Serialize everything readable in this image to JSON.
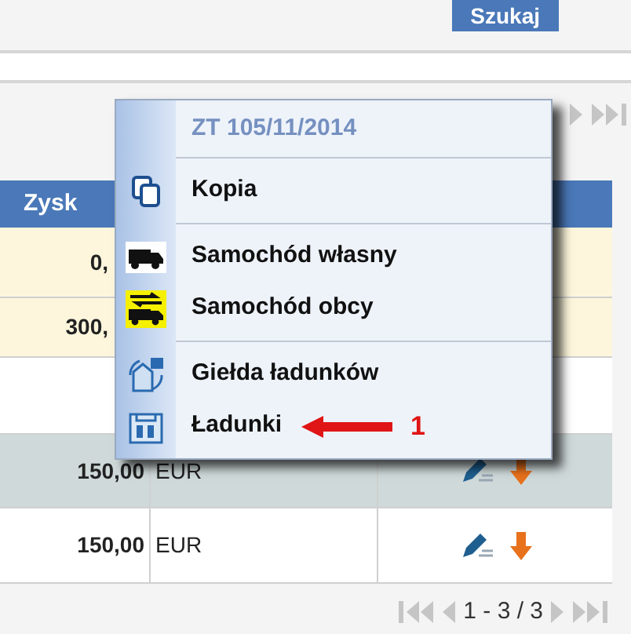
{
  "search_button": {
    "label": "Szukaj"
  },
  "table": {
    "columns": [
      {
        "label": "Zysk"
      }
    ],
    "rows": [
      {
        "kind": "highlighted",
        "amount": "0,"
      },
      {
        "kind": "highlighted",
        "amount": "300,"
      },
      {
        "kind": "plain"
      },
      {
        "kind": "selected",
        "amount": "150,00",
        "currency": "EUR",
        "actions": true
      },
      {
        "kind": "plain",
        "amount": "150,00",
        "currency": "EUR",
        "actions": true
      }
    ]
  },
  "pager": {
    "label": "1 - 3 / 3"
  },
  "context_menu": {
    "title": "ZT 105/11/2014",
    "sections": [
      [
        {
          "label": "Kopia",
          "kind": "copy"
        }
      ],
      [
        {
          "label": "Samochód własny",
          "kind": "own-truck"
        },
        {
          "label": "Samochód obcy",
          "kind": "foreign-truck"
        }
      ],
      [
        {
          "label": "Giełda ładunków",
          "kind": "exchange"
        },
        {
          "label": "Ładunki",
          "kind": "loads",
          "annotated": true
        }
      ]
    ]
  },
  "annotation": {
    "label": "1"
  }
}
